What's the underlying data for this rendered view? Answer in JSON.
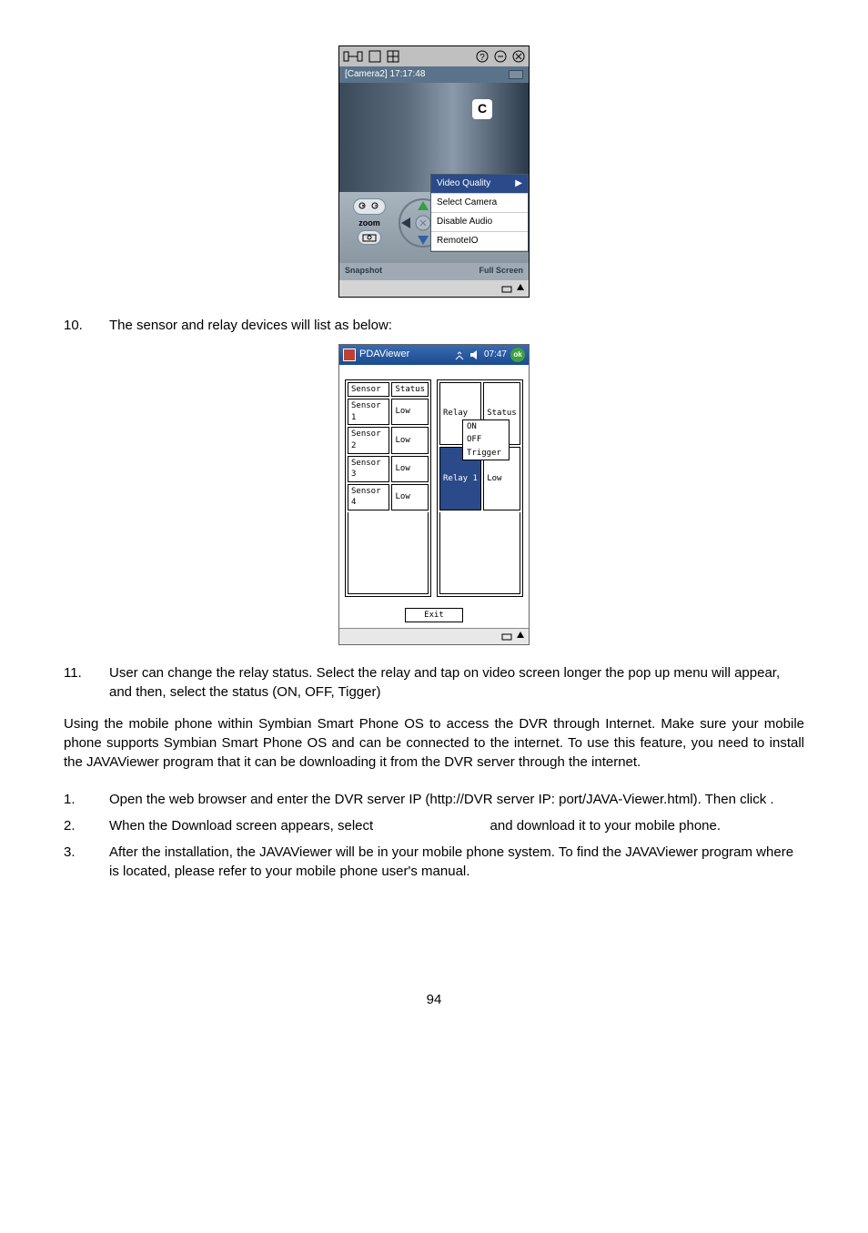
{
  "screenshot1": {
    "camera_label": "[Camera2] 17:17:48",
    "c_badge": "C",
    "menu": {
      "video_quality": "Video Quality",
      "select_camera": "Select Camera",
      "disable_audio": "Disable Audio",
      "remote_io": "RemoteIO"
    },
    "controls": {
      "zoom": "zoom",
      "focus": "Focus",
      "snapshot": "Snapshot",
      "full_screen": "Full Screen"
    }
  },
  "item10": {
    "num": "10.",
    "text": "The sensor and relay devices will list as below:"
  },
  "screenshot2": {
    "title": "PDAViewer",
    "time": "07:47",
    "ok": "ok",
    "sensor_table": {
      "h1": "Sensor",
      "h2": "Status",
      "rows": [
        [
          "Sensor 1",
          "Low"
        ],
        [
          "Sensor 2",
          "Low"
        ],
        [
          "Sensor 3",
          "Low"
        ],
        [
          "Sensor 4",
          "Low"
        ]
      ]
    },
    "relay_table": {
      "h1": "Relay",
      "h2": "Status",
      "rows": [
        [
          "Relay 1",
          "Low"
        ]
      ]
    },
    "popup": [
      "ON",
      "OFF",
      "Trigger"
    ],
    "exit": "Exit"
  },
  "item11": {
    "num": "11.",
    "text": "User can change the relay status. Select the relay and tap on video screen longer the pop up menu will appear, and then, select the status (ON, OFF, Tigger)"
  },
  "para1": "Using the mobile phone within Symbian Smart Phone OS to access the DVR through Internet. Make sure your mobile phone supports Symbian Smart Phone OS and can be connected to the internet. To use this feature, you need to install the JAVAViewer program that it can be downloading it from the DVR server through the internet.",
  "step1": {
    "num": "1.",
    "text": "Open the web browser and enter the DVR server IP (http://DVR server IP: port/JAVA-Viewer.html). Then click             ."
  },
  "step2": {
    "num": "2.",
    "text_a": "When the Download screen appears, select ",
    "text_b": " and download it to your mobile phone."
  },
  "step3": {
    "num": "3.",
    "text": "After the installation, the JAVAViewer will be in your mobile phone system. To find the JAVAViewer program where is located, please refer to your mobile phone user's manual."
  },
  "page_num": "94"
}
